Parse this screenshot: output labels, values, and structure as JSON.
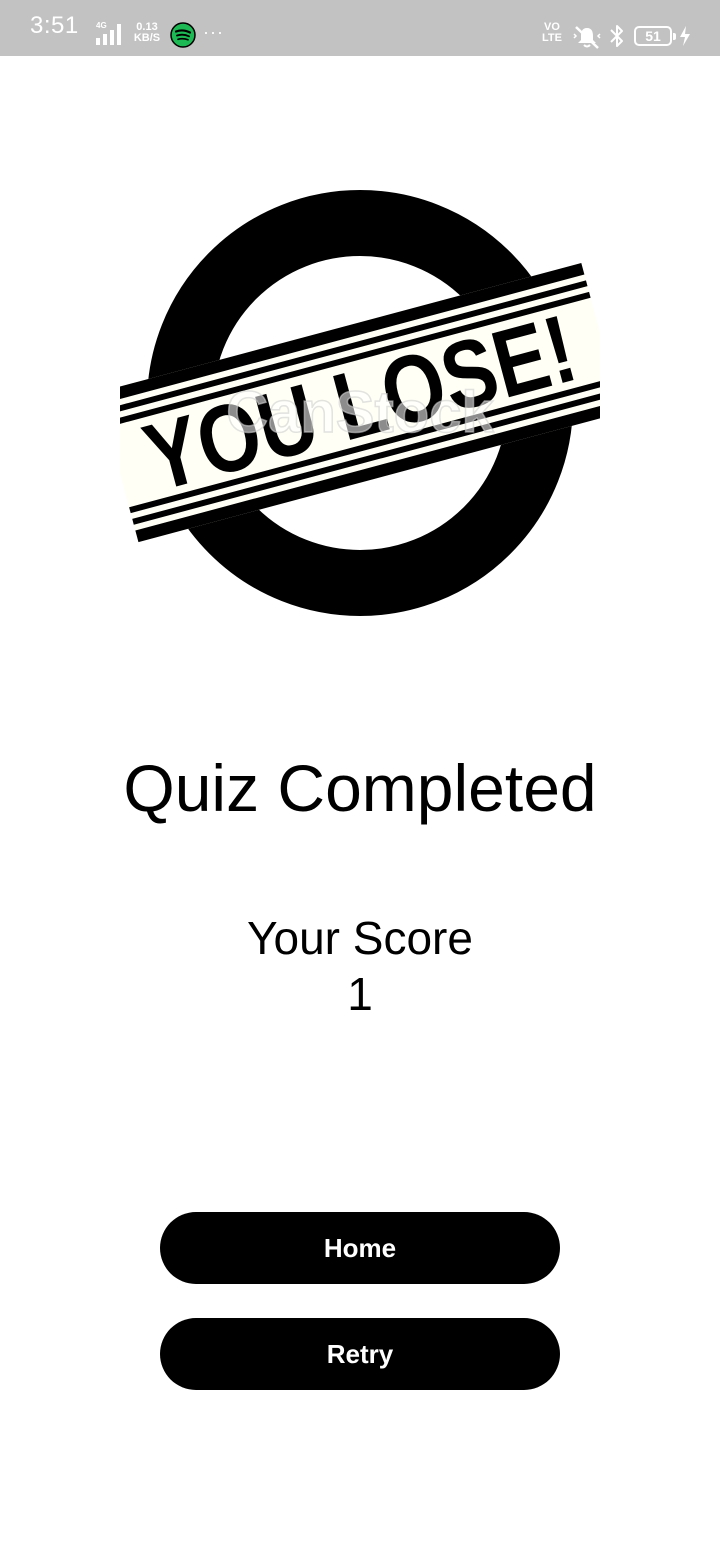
{
  "status_bar": {
    "time": "3:51",
    "network_type": "4G",
    "speed_value": "0.13",
    "speed_unit": "KB/S",
    "more_indicator": "···",
    "volte_top": "VO",
    "volte_bottom": "LTE",
    "battery_level": "51",
    "icons": [
      "signal-icon",
      "spotify-icon",
      "vibrate-mute-icon",
      "bluetooth-icon",
      "battery-icon",
      "charging-icon"
    ]
  },
  "result_image": {
    "text": "YOU LOSE!",
    "watermark": "CanStock",
    "colors": {
      "ring": "#000000",
      "banner": "#fffff6"
    }
  },
  "main": {
    "title": "Quiz Completed",
    "score_label": "Your Score",
    "score_value": "1"
  },
  "buttons": {
    "home_label": "Home",
    "retry_label": "Retry"
  },
  "colors": {
    "status_bar_bg": "#c2c2c2",
    "background": "#ffffff",
    "button_bg": "#000000",
    "button_text": "#ffffff"
  }
}
